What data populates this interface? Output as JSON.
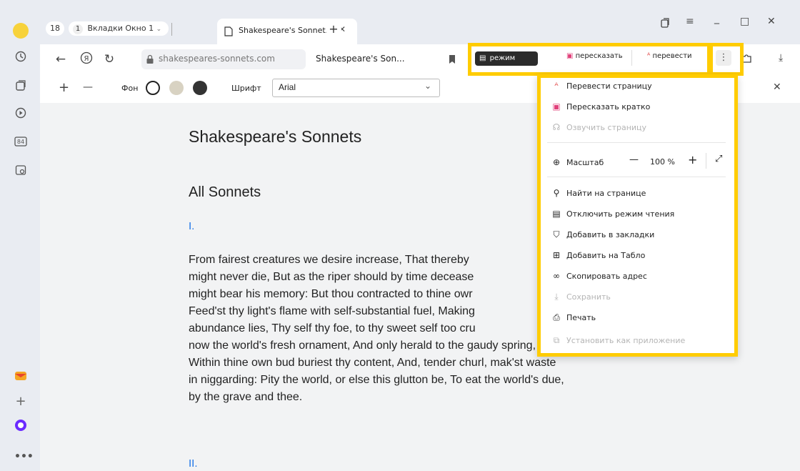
{
  "sidebar": {
    "icons": [
      "history-icon",
      "collections-icon",
      "play-icon",
      "cards-icon",
      "screenshot-icon"
    ],
    "bottom": [
      "mail-icon",
      "add-icon",
      "alice-icon",
      "more-icon"
    ]
  },
  "tabs": {
    "count_badge": "18",
    "group_badge": "1",
    "group_label": "Вкладки Окно 1",
    "active_tab_title": "Shakespeare's Sonnets",
    "new_tab_symbol": "+"
  },
  "window_controls": {
    "minimize": "_",
    "maximize": "□",
    "close": "✕"
  },
  "address": {
    "domain": "shakespeares-sonnets.com",
    "page_title": "Shakespeare's Son..."
  },
  "toolbar_buttons": {
    "reading_mode": "режим чтения",
    "retell": "пересказать",
    "translate": "перевести",
    "more": "⋮"
  },
  "reader_toolbar": {
    "zoom_in": "+",
    "zoom_out": "—",
    "background_label": "Фон",
    "font_label": "Шрифт",
    "font_value": "Arial",
    "close": "✕"
  },
  "article": {
    "title": "Shakespeare's Sonnets",
    "section": "All Sonnets",
    "first_link": "I.",
    "paragraph_lines": [
      "From fairest creatures we desire increase, That thereby",
      "might never die, But as the riper should by time decease",
      "might bear his memory: But thou contracted to thine owr",
      "Feed'st thy light's flame with self-substantial fuel, Making",
      "abundance lies, Thy self thy foe, to thy sweet self too cru",
      "now the world's fresh ornament, And only herald to the gaudy spring,",
      "Within thine own bud buriest thy content, And, tender churl, mak'st waste",
      "in niggarding: Pity the world, or else this glutton be, To eat the world's due,",
      "by the grave and thee."
    ],
    "second_link": "II."
  },
  "menu": {
    "translate_page": "Перевести страницу",
    "retell_short": "Пересказать кратко",
    "read_aloud": "Озвучить страницу",
    "zoom_label": "Масштаб",
    "zoom_minus": "—",
    "zoom_value": "100 %",
    "zoom_plus": "+",
    "find": "Найти на странице",
    "disable_reading": "Отключить режим чтения",
    "add_bookmark": "Добавить в закладки",
    "add_tablo": "Добавить на Табло",
    "copy_address": "Скопировать адрес",
    "save": "Сохранить",
    "print": "Печать",
    "install_app": "Установить как приложение"
  },
  "colors": {
    "highlight": "#ffcc00",
    "link": "#1a73e8",
    "reading_mode_bg": "#2b2b2b",
    "retell_accent": "#e0407a",
    "translate_accent": "#e04040"
  }
}
